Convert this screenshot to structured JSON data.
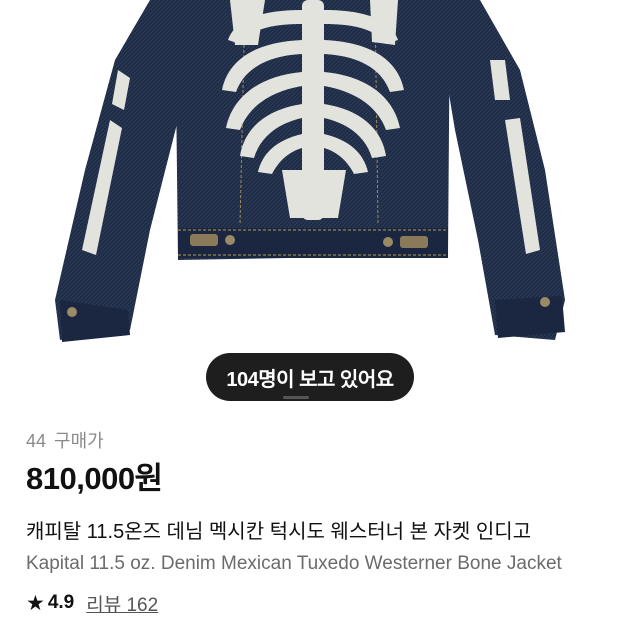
{
  "hero": {
    "viewers_text": "104명이 보고 있어요"
  },
  "product": {
    "purchase_count": "44",
    "purchase_label": "구매가",
    "price": "810,000원",
    "name_ko": "캐피탈 11.5온즈 데님 멕시칸 턱시도 웨스터너 본 자켓 인디고",
    "name_en": "Kapital 11.5 oz. Denim Mexican Tuxedo Westerner Bone Jacket",
    "rating": "4.9",
    "reviews_label": "리뷰 162"
  },
  "colors": {
    "denim": "#1f2c45",
    "bone_print": "#e3e3de",
    "pill_bg": "#1e1e1e"
  },
  "icons": {
    "star": "star-icon"
  }
}
